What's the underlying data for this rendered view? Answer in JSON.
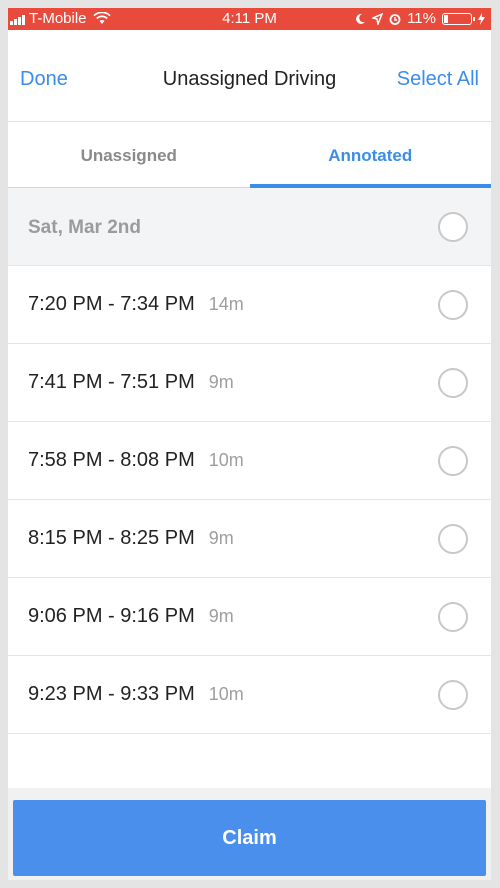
{
  "status_bar": {
    "carrier": "T-Mobile",
    "time": "4:11 PM",
    "battery": "11%",
    "color": "#e84b3c"
  },
  "nav": {
    "done_label": "Done",
    "title": "Unassigned Driving",
    "select_all_label": "Select All",
    "accent": "#3b8de8"
  },
  "tabs": [
    {
      "label": "Unassigned",
      "active": false
    },
    {
      "label": "Annotated",
      "active": true
    }
  ],
  "section": {
    "date": "Sat, Mar 2nd"
  },
  "trips": [
    {
      "range": "7:20 PM - 7:34 PM",
      "duration": "14m"
    },
    {
      "range": "7:41 PM - 7:51 PM",
      "duration": "9m"
    },
    {
      "range": "7:58 PM - 8:08 PM",
      "duration": "10m"
    },
    {
      "range": "8:15 PM - 8:25 PM",
      "duration": "9m"
    },
    {
      "range": "9:06 PM - 9:16 PM",
      "duration": "9m"
    },
    {
      "range": "9:23 PM - 9:33 PM",
      "duration": "10m"
    }
  ],
  "claim": {
    "label": "Claim",
    "color": "#4a8fec"
  }
}
